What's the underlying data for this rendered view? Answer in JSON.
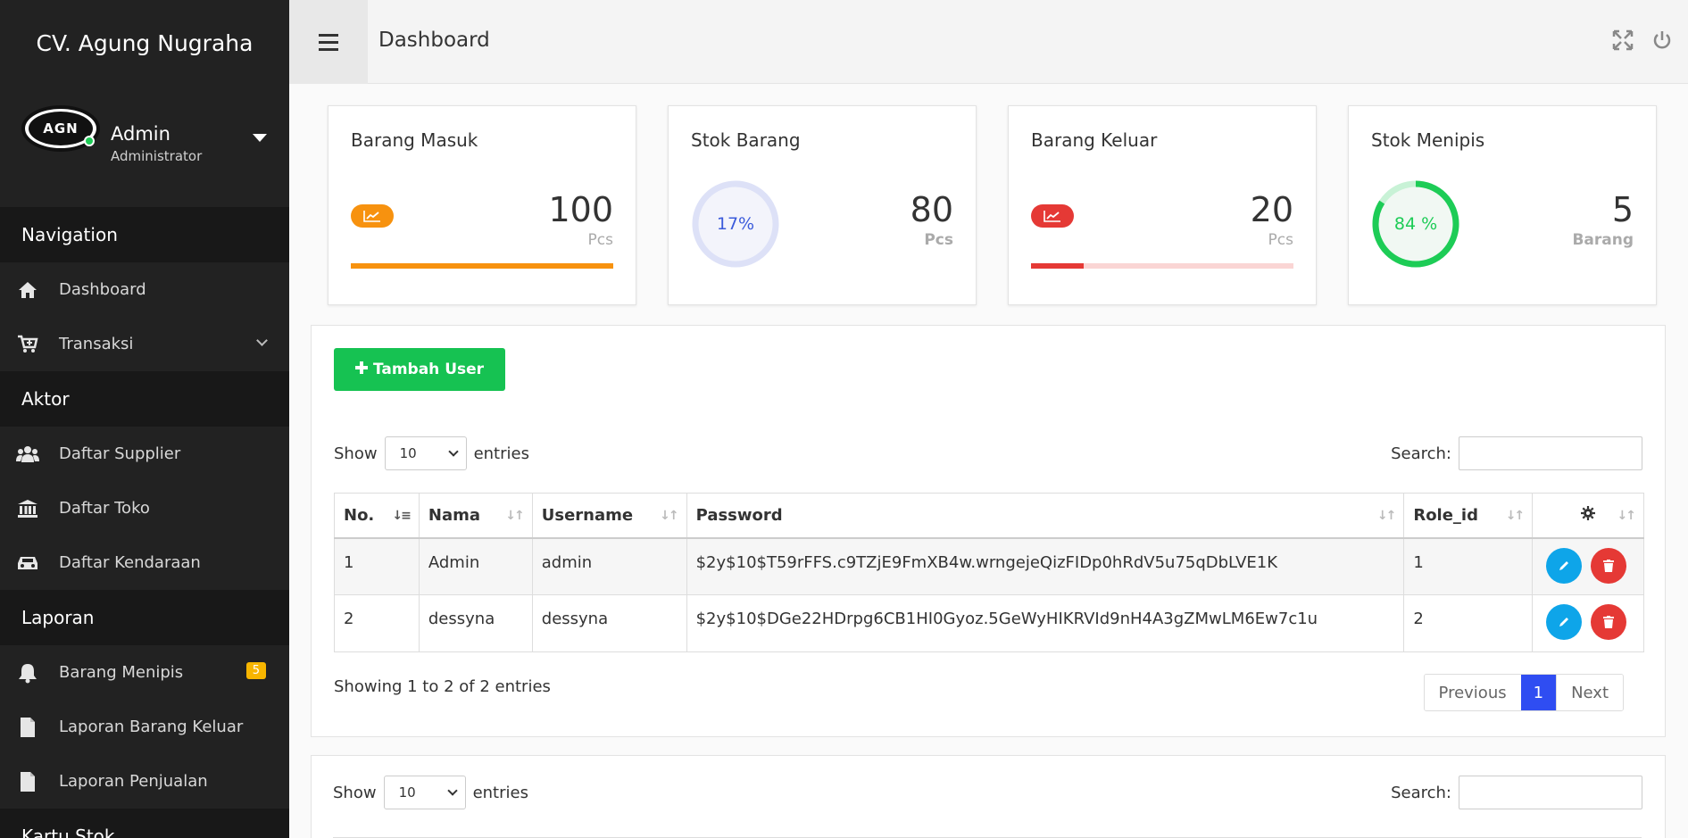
{
  "brand": "CV. Agung Nugraha",
  "user": {
    "name": "Admin",
    "role": "Administrator",
    "avatar_text": "AGN"
  },
  "nav": {
    "section_navigation": "Navigation",
    "dashboard": "Dashboard",
    "transaksi": "Transaksi",
    "section_aktor": "Aktor",
    "daftar_supplier": "Daftar Supplier",
    "daftar_toko": "Daftar Toko",
    "daftar_kendaraan": "Daftar Kendaraan",
    "section_laporan": "Laporan",
    "barang_menipis": "Barang Menipis",
    "barang_menipis_badge": "5",
    "laporan_barang_keluar": "Laporan Barang Keluar",
    "laporan_penjualan": "Laporan Penjualan",
    "section_kartu_stok": "Kartu Stok"
  },
  "topbar": {
    "title": "Dashboard"
  },
  "cards": [
    {
      "title": "Barang Masuk",
      "value": "100",
      "unit": "Pcs",
      "progress": 1.0,
      "color": "#f7920f"
    },
    {
      "title": "Stok Barang",
      "value": "80",
      "unit": "Pcs",
      "percent_label": "17%",
      "percent": 0.17,
      "color": "#3b5bdb"
    },
    {
      "title": "Barang Keluar",
      "value": "20",
      "unit": "Pcs",
      "progress": 0.2,
      "color": "#e53935"
    },
    {
      "title": "Stok Menipis",
      "value": "5",
      "unit": "Barang",
      "percent_label": "84 %",
      "percent": 0.84,
      "color": "#1dcc56"
    }
  ],
  "users_table": {
    "add_button": "Tambah User",
    "show_label": "Show",
    "entries_label": "entries",
    "page_length": "10",
    "search_label": "Search:",
    "columns": [
      "No.",
      "Nama",
      "Username",
      "Password",
      "Role_id"
    ],
    "rows": [
      {
        "no": "1",
        "nama": "Admin",
        "username": "admin",
        "password": "$2y$10$T59rFFS.c9TZjE9FmXB4w.wrngejeQizFIDp0hRdV5u75qDbLVE1K",
        "role_id": "1"
      },
      {
        "no": "2",
        "nama": "dessyna",
        "username": "dessyna",
        "password": "$2y$10$DGe22HDrpg6CB1HI0Gyoz.5GeWyHIKRVId9nH4A3gZMwLM6Ew7c1u",
        "role_id": "2"
      }
    ],
    "info": "Showing 1 to 2 of 2 entries",
    "pager": {
      "previous": "Previous",
      "page": "1",
      "next": "Next"
    }
  },
  "second_table": {
    "show_label": "Show",
    "entries_label": "entries",
    "page_length": "10",
    "search_label": "Search:"
  },
  "colors": {
    "sidebar": "#222222",
    "accent_green": "#16c252",
    "pager_active": "#2f4df2",
    "edit": "#0ea5e9",
    "delete": "#e53935"
  }
}
